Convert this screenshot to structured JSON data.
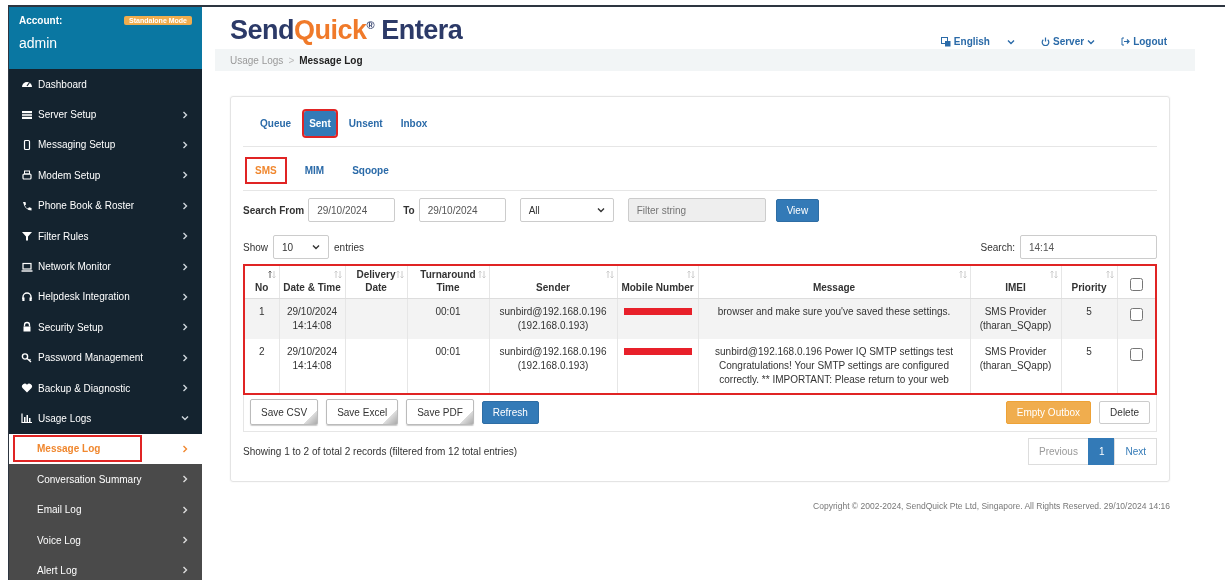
{
  "sidebar": {
    "account_label": "Account:",
    "mode_badge": "Standalone Mode",
    "user": "admin",
    "items": [
      {
        "label": "Dashboard",
        "submenu": false
      },
      {
        "label": "Server Setup",
        "submenu": true,
        "expanded": false
      },
      {
        "label": "Messaging Setup",
        "submenu": true,
        "expanded": false
      },
      {
        "label": "Modem Setup",
        "submenu": true,
        "expanded": false
      },
      {
        "label": "Phone Book & Roster",
        "submenu": true,
        "expanded": false
      },
      {
        "label": "Filter Rules",
        "submenu": true,
        "expanded": false
      },
      {
        "label": "Network Monitor",
        "submenu": true,
        "expanded": false
      },
      {
        "label": "Helpdesk Integration",
        "submenu": true,
        "expanded": false
      },
      {
        "label": "Security Setup",
        "submenu": true,
        "expanded": false
      },
      {
        "label": "Password Management",
        "submenu": true,
        "expanded": false
      },
      {
        "label": "Backup & Diagnostic",
        "submenu": true,
        "expanded": false
      },
      {
        "label": "Usage Logs",
        "submenu": true,
        "expanded": true,
        "children": [
          {
            "label": "Message Log",
            "selected": true,
            "annotated": true
          },
          {
            "label": "Conversation Summary",
            "selected": false,
            "annotated": false
          },
          {
            "label": "Email Log",
            "selected": false,
            "annotated": false
          },
          {
            "label": "Voice Log",
            "selected": false,
            "annotated": false
          },
          {
            "label": "Alert Log",
            "selected": false,
            "annotated": false
          }
        ]
      }
    ]
  },
  "header": {
    "logo": {
      "part_1": "Send",
      "part_2": "Quick",
      "mark": "®",
      "product": "Entera"
    },
    "language": "English",
    "server": "Server",
    "logout": "Logout"
  },
  "breadcrumb": {
    "items": [
      "Usage Logs",
      "Message Log"
    ],
    "separator": ">"
  },
  "tabs": [
    {
      "label": "Queue",
      "selected": false,
      "annotated": false
    },
    {
      "label": "Sent",
      "selected": true,
      "annotated": true
    },
    {
      "label": "Unsent",
      "selected": false,
      "annotated": false
    },
    {
      "label": "Inbox",
      "selected": false,
      "annotated": false
    }
  ],
  "subtabs": [
    {
      "label": "SMS",
      "selected": true,
      "annotated": true
    },
    {
      "label": "MIM",
      "selected": false,
      "annotated": false
    },
    {
      "label": "Sqoope",
      "selected": false,
      "annotated": false
    }
  ],
  "filters": {
    "from_label": "Search From",
    "from": "29/10/2024",
    "to_label": "To",
    "to": "29/10/2024",
    "type": "All",
    "filter_placeholder": "Filter string",
    "filter_disabled": true,
    "button": "View"
  },
  "list_controls": {
    "show_label": "Show",
    "page_size": "10",
    "entries_label": "entries",
    "search_label": "Search:",
    "search": "14:14"
  },
  "table": {
    "annotated": true,
    "columns": [
      {
        "label": "No",
        "sorted": true
      },
      {
        "label": "Date & Time",
        "sorted": false
      },
      {
        "label": "Delivery Date",
        "sorted": false
      },
      {
        "label": "Turnaround Time",
        "sorted": false
      },
      {
        "label": "Sender",
        "sorted": false
      },
      {
        "label": "Mobile Number",
        "sorted": false
      },
      {
        "label": "Message",
        "sorted": false
      },
      {
        "label": "IMEI",
        "sorted": false
      },
      {
        "label": "Priority",
        "sorted": false
      }
    ],
    "select_all": false,
    "rows": [
      {
        "no": "1",
        "date": "29/10/2024 14:14:08",
        "delivery": "",
        "turnaround": "00:01",
        "sender": "sunbird@192.168.0.196 (192.168.0.193)",
        "mobile_redacted": true,
        "message": "browser and make sure you've saved these settings.",
        "imei": "SMS Provider (tharan_SQapp)",
        "priority": "5",
        "checked": false
      },
      {
        "no": "2",
        "date": "29/10/2024 14:14:08",
        "delivery": "",
        "turnaround": "00:01",
        "sender": "sunbird@192.168.0.196 (192.168.0.193)",
        "mobile_redacted": true,
        "message": "sunbird@192.168.0.196 Power IQ SMTP settings test Congratulations! Your SMTP settings are configured correctly. ** IMPORTANT: Please return to your web",
        "imei": "SMS Provider (tharan_SQapp)",
        "priority": "5",
        "checked": false
      }
    ]
  },
  "actions": [
    {
      "label": "Save CSV",
      "kind": "export"
    },
    {
      "label": "Save Excel",
      "kind": "export"
    },
    {
      "label": "Save PDF",
      "kind": "export"
    },
    {
      "label": "Refresh",
      "kind": "primary"
    },
    {
      "label": "Empty Outbox",
      "kind": "warning"
    },
    {
      "label": "Delete",
      "kind": "plain"
    }
  ],
  "info": "Showing 1 to 2 of total 2 records (filtered from 12 total entries)",
  "pagination": [
    {
      "label": "Previous",
      "selected": false,
      "disabled": true
    },
    {
      "label": "1",
      "selected": true,
      "disabled": false
    },
    {
      "label": "Next",
      "selected": false,
      "disabled": false
    }
  ],
  "footer": "Copyright © 2002-2024, SendQuick Pte Ltd, Singapore. All Rights Reserved. 29/10/2024 14:16"
}
